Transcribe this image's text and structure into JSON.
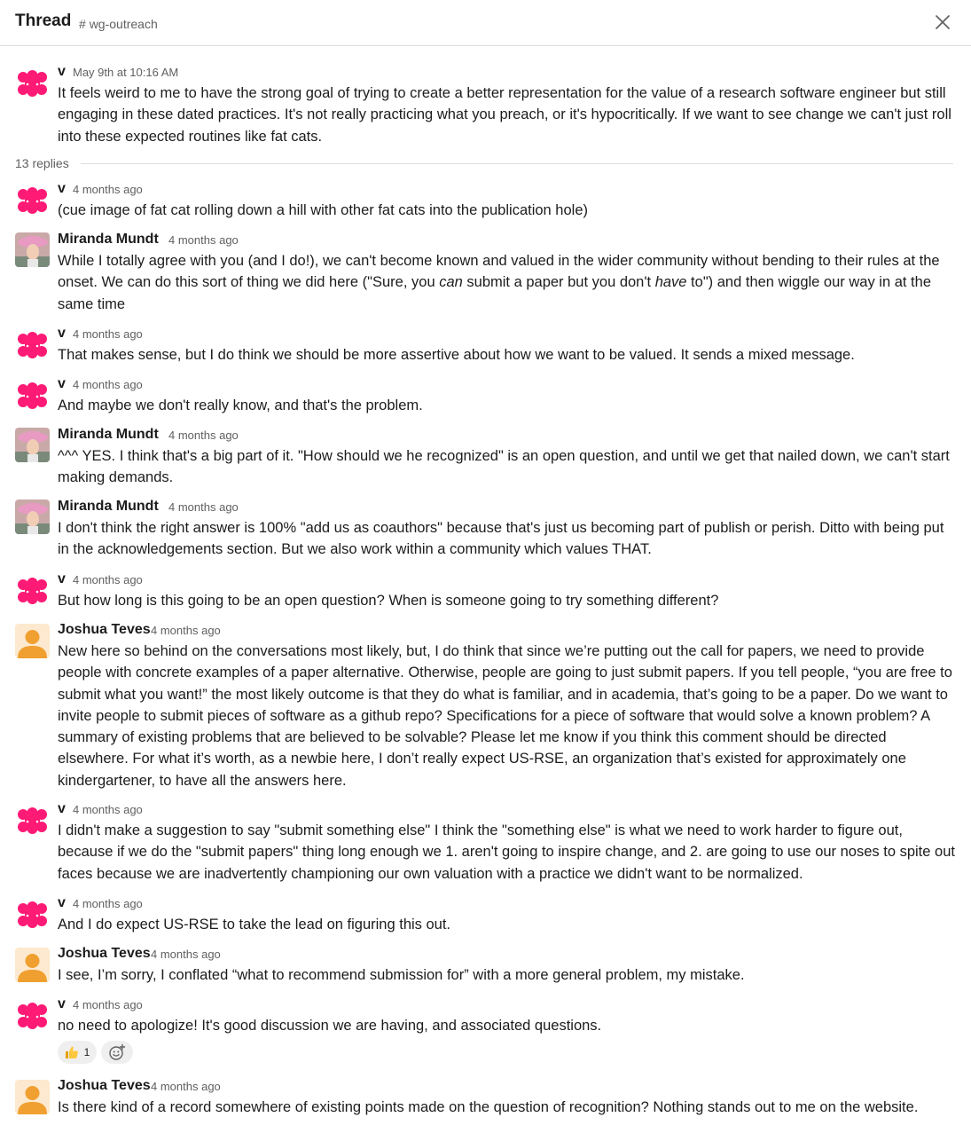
{
  "header": {
    "title": "Thread",
    "channel_hash": "#",
    "channel_name": "wg-outreach"
  },
  "parent": {
    "author": "v",
    "time": "May 9th at 10:16 AM",
    "text": "It feels weird to me to have the strong goal of trying to create a better representation for the value of a research software engineer but still engaging in these dated practices. It's not really practicing what you preach, or it's hypocritically. If we want to see change we can't just roll into these expected routines like fat cats."
  },
  "replies_label": "13 replies",
  "replies": [
    {
      "author": "v",
      "time": "4 months ago",
      "text": "(cue image of fat cat rolling down a hill with other fat cats into the publication hole)"
    },
    {
      "author": "Miranda Mundt",
      "time": "4 months ago",
      "text_a": "While I totally agree with you (and I do!), we can't become known and valued in the wider community without bending to their rules at the onset. We can do this sort of thing we did here (\"Sure, you ",
      "text_em1": "can",
      "text_b": " submit a paper but you don't ",
      "text_em2": "have",
      "text_c": " to\") and then wiggle our way in at the same time"
    },
    {
      "author": "v",
      "time": "4 months ago",
      "text": "That makes sense, but I do think we should be more assertive about how we want to be valued. It sends a mixed message."
    },
    {
      "author": "v",
      "time": "4 months ago",
      "text": "And maybe we don't really know, and that's the problem."
    },
    {
      "author": "Miranda Mundt",
      "time": "4 months ago",
      "text": "^^^ YES. I think that's a big part of it. \"How should we he recognized\" is an open question, and until we get that nailed down, we can't start making demands."
    },
    {
      "author": "Miranda Mundt",
      "time": "4 months ago",
      "text": "I don't think the right answer is 100% \"add us as coauthors\" because that's just us becoming part of publish or perish. Ditto with being put in the acknowledgements section. But we also work within a community which values THAT."
    },
    {
      "author": "v",
      "time": "4 months ago",
      "text": "But how long is this going to be an open question? When is someone going to try something different?"
    },
    {
      "author": "Joshua Teves",
      "time": "4 months ago",
      "text": "New here so behind on the conversations most likely, but, I do think that since we’re putting out the call for papers, we need to provide people with concrete examples of a paper alternative. Otherwise, people are going to just submit papers. If you tell people, “you are free to submit what you want!” the most likely outcome is that they do what is familiar, and in academia, that’s going to be a paper. Do we want to invite people to submit pieces of software as a github repo? Specifications for a piece of software that would solve a known problem? A summary of existing problems that are believed to be solvable? Please let me know if you think this comment should be directed elsewhere. For what it’s worth, as a newbie here, I don’t really expect US-RSE, an organization that’s existed for approximately one kindergartener, to have all the answers here."
    },
    {
      "author": "v",
      "time": "4 months ago",
      "text": "I didn't make a suggestion to say \"submit something else\" I think the \"something else\" is what we need to work harder to figure out, because if we do the \"submit papers\" thing long enough we 1. aren't going to inspire change, and 2. are going to use our noses to spite out faces because we are inadvertently championing our own valuation with a practice we didn't want to be normalized."
    },
    {
      "author": "v",
      "time": "4 months ago",
      "text": "And I do expect US-RSE to take the lead on figuring this out."
    },
    {
      "author": "Joshua Teves",
      "time": "4 months ago",
      "text": "I see, I’m sorry, I conflated “what to recommend submission for” with a more general problem, my mistake."
    },
    {
      "author": "v",
      "time": "4 months ago",
      "text": "no need to apologize! It's good discussion we are having, and associated questions.",
      "reaction_emoji": "thumbs-up",
      "reaction_count": "1",
      "add_reaction_icon": "add-reaction-icon"
    },
    {
      "author": "Joshua Teves",
      "time": "4 months ago",
      "text": "Is there kind of a record somewhere of existing points made on the question of recognition? Nothing stands out to me on the website."
    }
  ],
  "colors": {
    "v_avatar": "#ff1a75",
    "joshua_avatar_bg": "#fde9cf",
    "joshua_avatar_fg": "#f0a030",
    "muted_text": "#616061",
    "divider": "#dddddd"
  }
}
